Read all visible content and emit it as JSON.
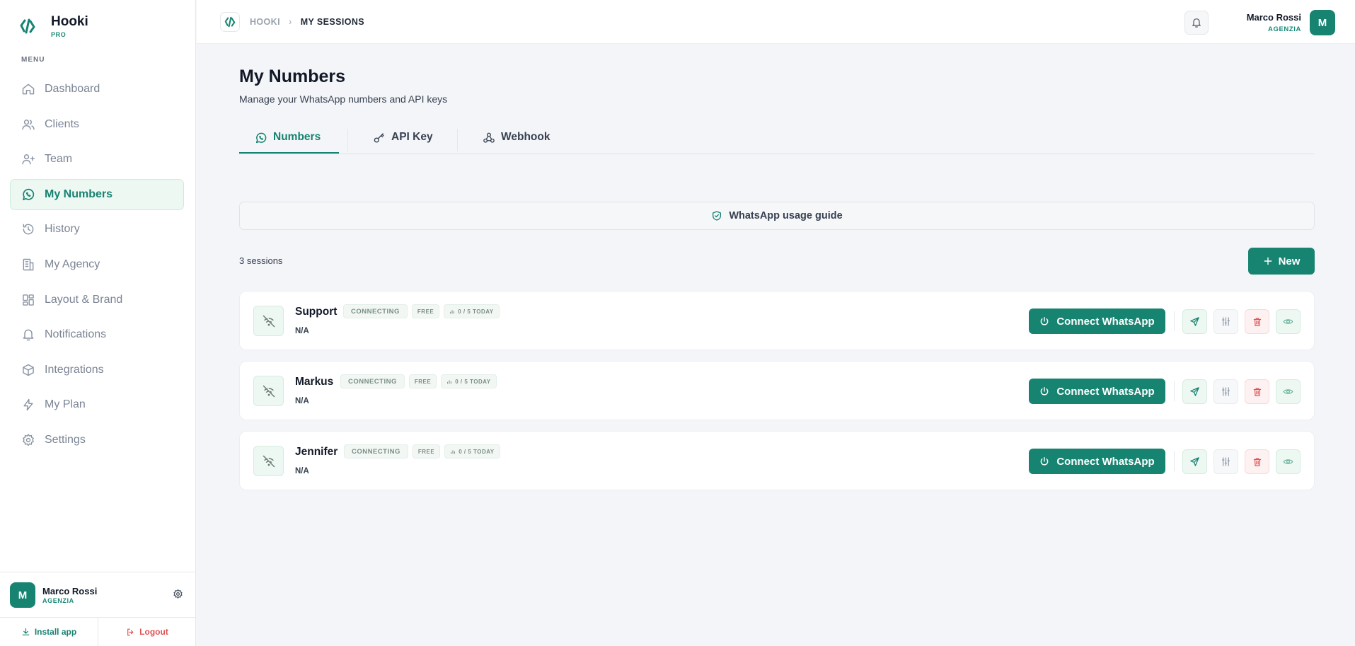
{
  "brand": {
    "name": "Hooki",
    "tier": "PRO"
  },
  "sidebar": {
    "menu_label": "MENU",
    "items": [
      {
        "label": "Dashboard",
        "icon": "home-icon"
      },
      {
        "label": "Clients",
        "icon": "users-icon"
      },
      {
        "label": "Team",
        "icon": "user-plus-icon"
      },
      {
        "label": "My Numbers",
        "icon": "whatsapp-icon",
        "active": true
      },
      {
        "label": "History",
        "icon": "history-icon"
      },
      {
        "label": "My Agency",
        "icon": "building-icon"
      },
      {
        "label": "Layout & Brand",
        "icon": "layout-icon"
      },
      {
        "label": "Notifications",
        "icon": "bell-icon"
      },
      {
        "label": "Integrations",
        "icon": "box-icon"
      },
      {
        "label": "My Plan",
        "icon": "bolt-icon"
      },
      {
        "label": "Settings",
        "icon": "gear-icon"
      }
    ],
    "user": {
      "initial": "M",
      "name": "Marco Rossi",
      "role": "AGENZIA"
    },
    "install_label": "Install app",
    "logout_label": "Logout"
  },
  "header": {
    "breadcrumb": {
      "root": "HOOKI",
      "current": "MY SESSIONS"
    },
    "user": {
      "initial": "M",
      "name": "Marco Rossi",
      "role": "AGENZIA"
    }
  },
  "main": {
    "title": "My Numbers",
    "subtitle": "Manage your WhatsApp numbers and API keys",
    "tabs": [
      {
        "label": "Numbers",
        "icon": "whatsapp-icon",
        "active": true
      },
      {
        "label": "API Key",
        "icon": "key-icon"
      },
      {
        "label": "Webhook",
        "icon": "webhook-icon"
      }
    ],
    "guide_label": "WhatsApp usage guide",
    "count_label": "3 sessions",
    "new_label": "New"
  },
  "sessions": [
    {
      "name": "Support",
      "status": "CONNECTING",
      "plan": "FREE",
      "usage": "0 / 5 TODAY",
      "number": "N/A",
      "connect_label": "Connect WhatsApp"
    },
    {
      "name": "Markus",
      "status": "CONNECTING",
      "plan": "FREE",
      "usage": "0 / 5 TODAY",
      "number": "N/A",
      "connect_label": "Connect WhatsApp"
    },
    {
      "name": "Jennifer",
      "status": "CONNECTING",
      "plan": "FREE",
      "usage": "0 / 5 TODAY",
      "number": "N/A",
      "connect_label": "Connect WhatsApp"
    }
  ],
  "colors": {
    "accent": "#178471",
    "accent_text": "#168270",
    "danger": "#e05252"
  }
}
